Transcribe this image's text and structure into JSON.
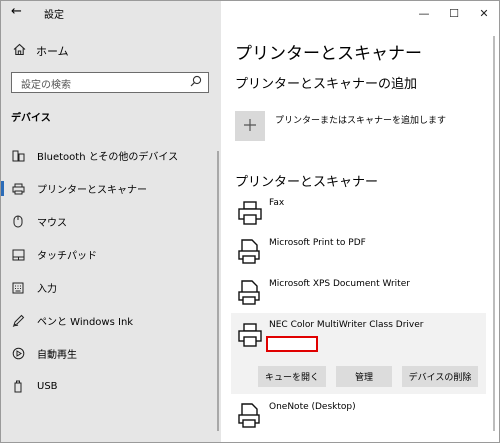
{
  "window": {
    "back_glyph": "←",
    "title": "設定",
    "minimize_glyph": "—",
    "maximize_glyph": "☐",
    "close_glyph": "✕"
  },
  "sidebar": {
    "home_label": "ホーム",
    "search_placeholder": "設定の検索",
    "section_label": "デバイス",
    "items": [
      {
        "label": "Bluetooth とその他のデバイス",
        "icon": "bluetooth-devices-icon"
      },
      {
        "label": "プリンターとスキャナー",
        "icon": "printer-icon",
        "active": true
      },
      {
        "label": "マウス",
        "icon": "mouse-icon"
      },
      {
        "label": "タッチパッド",
        "icon": "touchpad-icon"
      },
      {
        "label": "入力",
        "icon": "keyboard-icon"
      },
      {
        "label": "ペンと Windows Ink",
        "icon": "pen-icon"
      },
      {
        "label": "自動再生",
        "icon": "autoplay-icon"
      },
      {
        "label": "USB",
        "icon": "usb-icon"
      }
    ]
  },
  "main": {
    "title": "プリンターとスキャナー",
    "add_section_title": "プリンターとスキャナーの追加",
    "add_button_label": "プリンターまたはスキャナーを追加します",
    "list_title": "プリンターとスキャナー",
    "printers": [
      {
        "name": "Fax"
      },
      {
        "name": "Microsoft Print to PDF"
      },
      {
        "name": "Microsoft XPS Document Writer"
      },
      {
        "name": "NEC Color MultiWriter Class Driver",
        "selected": true
      },
      {
        "name": "OneNote (Desktop)"
      }
    ],
    "selected_actions": {
      "open_queue": "キューを開く",
      "manage": "管理",
      "remove_device": "デバイスの削除"
    }
  },
  "colors": {
    "accent": "#2b6cb8",
    "highlight_box": "#e00000",
    "sidebar_bg": "#e6e6e6"
  }
}
